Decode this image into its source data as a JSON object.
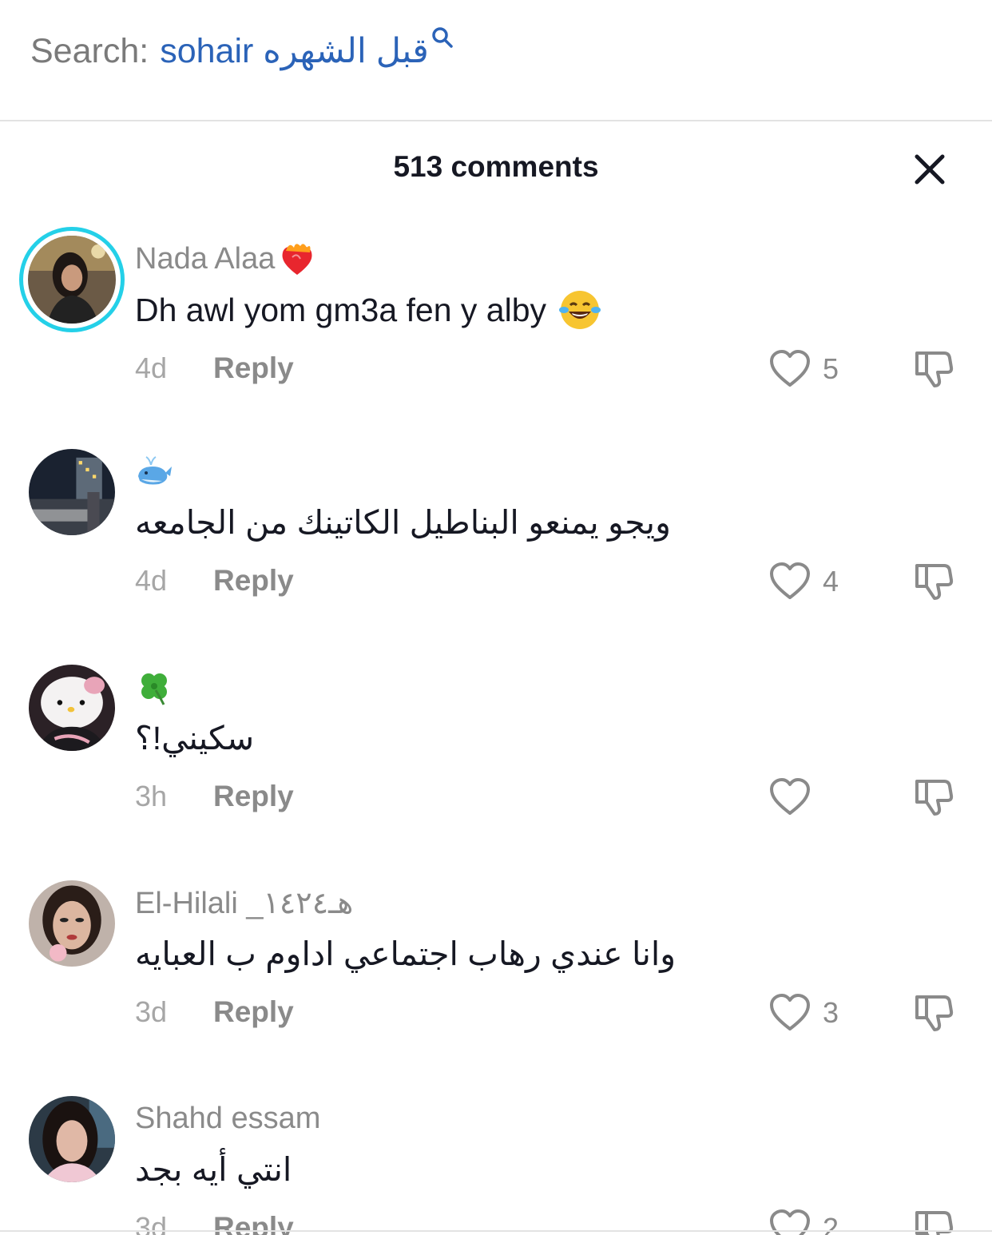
{
  "search": {
    "label": "Search:",
    "query": "sohair قبل الشهره"
  },
  "sheet": {
    "title": "513 comments"
  },
  "comments": [
    {
      "username": "Nada Alaa",
      "username_emoji": "heart-on-fire",
      "text": "Dh awl yom gm3a fen y alby",
      "text_emoji": "tears-of-joy",
      "time": "4d",
      "reply": "Reply",
      "likes": "5"
    },
    {
      "username": "",
      "username_emoji": "whale",
      "text": "ويجو يمنعو البناطيل الكاتينك من الجامعه",
      "time": "4d",
      "reply": "Reply",
      "likes": "4"
    },
    {
      "username": "",
      "username_emoji": "four-leaf-clover",
      "text": "سكيني!؟",
      "time": "3h",
      "reply": "Reply",
      "likes": ""
    },
    {
      "username": "El-Hilali _هـ١٤٢٤",
      "text": "وانا عندي رهاب اجتماعي اداوم ب العبايه",
      "time": "3d",
      "reply": "Reply",
      "likes": "3"
    },
    {
      "username": "Shahd essam",
      "text": "انتي أيه بجد",
      "time": "3d",
      "reply": "Reply",
      "likes": "2"
    }
  ],
  "colors": {
    "search_query": "#2b63b8",
    "story_ring": "#24d0e8",
    "username": "#8a8a8a",
    "text": "#161823"
  }
}
